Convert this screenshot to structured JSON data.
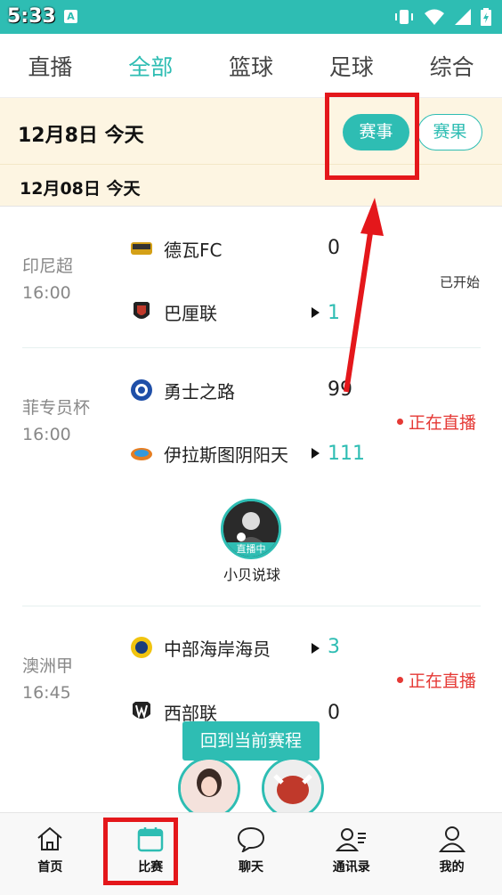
{
  "status_bar": {
    "time": "5:33",
    "app_icon_letter": "A",
    "icons": [
      "vibrate-icon",
      "wifi-icon",
      "signal-icon",
      "battery-icon"
    ]
  },
  "tabs": [
    {
      "label": "直播",
      "active": false
    },
    {
      "label": "全部",
      "active": true
    },
    {
      "label": "篮球",
      "active": false
    },
    {
      "label": "足球",
      "active": false
    },
    {
      "label": "综合",
      "active": false
    }
  ],
  "date_header": {
    "date": "12月8日  今天",
    "event_button": "赛事",
    "result_button": "赛果"
  },
  "date_sub": {
    "label": "12月08日   今天"
  },
  "matches": [
    {
      "league": "印尼超",
      "time": "16:00",
      "home": "德瓦FC",
      "away": "巴厘联",
      "home_score": "0",
      "away_score": "1",
      "status": "已开始"
    },
    {
      "league": "菲专员杯",
      "time": "16:00",
      "home": "勇士之路",
      "away": "伊拉斯图阴阳天",
      "home_score": "99",
      "away_score": "111",
      "status": "正在直播"
    },
    {
      "league": "澳洲甲",
      "time": "16:45",
      "home": "中部海岸海员",
      "away": "西部联",
      "home_score": "3",
      "away_score": "0",
      "status": "正在直播"
    }
  ],
  "streamer": {
    "name": "小贝说球",
    "badge": "直播中"
  },
  "back_button": "回到当前赛程",
  "bottom_nav": [
    {
      "label": "首页",
      "icon": "home-icon"
    },
    {
      "label": "比赛",
      "icon": "calendar-icon"
    },
    {
      "label": "聊天",
      "icon": "chat-icon"
    },
    {
      "label": "通讯录",
      "icon": "contacts-icon"
    },
    {
      "label": "我的",
      "icon": "user-icon"
    }
  ],
  "colors": {
    "accent": "#2ebdb3",
    "live_red": "#e53935",
    "annotation_red": "#e4171b",
    "date_bg": "#fdf5e2"
  }
}
